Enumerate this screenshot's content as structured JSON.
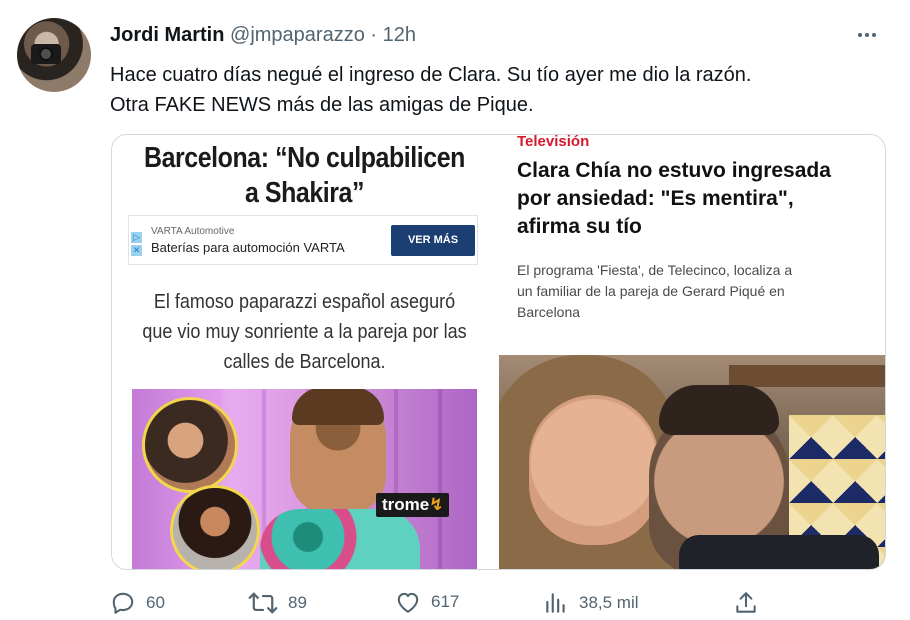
{
  "tweet": {
    "author_name": "Jordi Martin",
    "author_handle": "@jmpaparazzo",
    "separator": "·",
    "time": "12h",
    "text_lines": [
      "Hace cuatro días negué el ingreso de Clara. Su tío ayer me dio la razón.",
      "Otra FAKE NEWS más de las amigas de Pique."
    ]
  },
  "media": {
    "left": {
      "headline_lines": [
        "Barcelona: “No culpabilicen",
        "a Shakira”"
      ],
      "ad": {
        "brand": "VARTA Automotive",
        "title": "Baterías para automoción VARTA",
        "button_label": "VER MÁS"
      },
      "quote_lines": [
        "El famoso paparazzi español aseguró",
        "que vio muy sonriente a la pareja por las",
        "calles de Barcelona."
      ],
      "logo_text": "trome",
      "logo_mark": "↯"
    },
    "right": {
      "section": "Televisión",
      "headline_lines": [
        "Clara Chía no estuvo ingresada",
        "por ansiedad: \"Es mentira\",",
        "afirma su tío"
      ],
      "subtitle_lines": [
        "El programa 'Fiesta', de Telecinco, localiza a",
        "un familiar de la pareja de Gerard Piqué en",
        "Barcelona"
      ]
    }
  },
  "actions": {
    "replies": "60",
    "retweets": "89",
    "likes": "617",
    "views": "38,5 mil"
  },
  "colors": {
    "text_primary": "#0f1419",
    "text_secondary": "#536471",
    "border": "#cfd9de",
    "section_red": "#d61a2e",
    "ad_button": "#1b3f73"
  }
}
